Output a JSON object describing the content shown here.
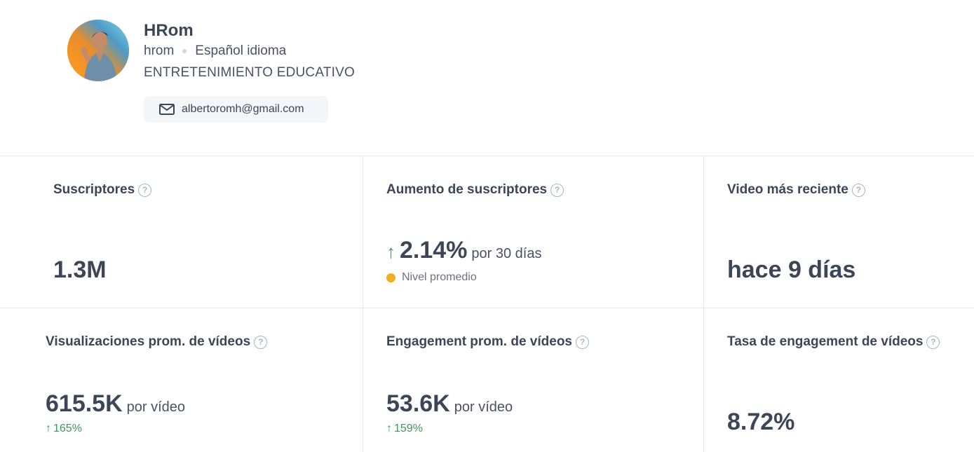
{
  "profile": {
    "name": "HRom",
    "handle": "hrom",
    "language": "Español idioma",
    "category": "ENTRETENIMIENTO EDUCATIVO",
    "email": "albertoromh@gmail.com"
  },
  "stats": {
    "subscribers": {
      "label": "Suscriptores",
      "value": "1.3M"
    },
    "growth": {
      "label": "Aumento de suscriptores",
      "value": "2.14%",
      "unit": "por 30 días",
      "level": "Nivel promedio",
      "level_color": "#f0ad1e"
    },
    "recent": {
      "label": "Video más reciente",
      "value": "hace 9 días"
    },
    "avg_views": {
      "label": "Visualizaciones prom. de vídeos",
      "value": "615.5K",
      "unit": "por vídeo",
      "trend": "165%"
    },
    "avg_engagement": {
      "label": "Engagement prom. de vídeos",
      "value": "53.6K",
      "unit": "por vídeo",
      "trend": "159%"
    },
    "engagement_rate": {
      "label": "Tasa de engagement de vídeos",
      "value": "8.72%"
    }
  },
  "colors": {
    "positive": "#3a9a5c",
    "border": "#e4e7eb",
    "text": "#3d4656"
  }
}
